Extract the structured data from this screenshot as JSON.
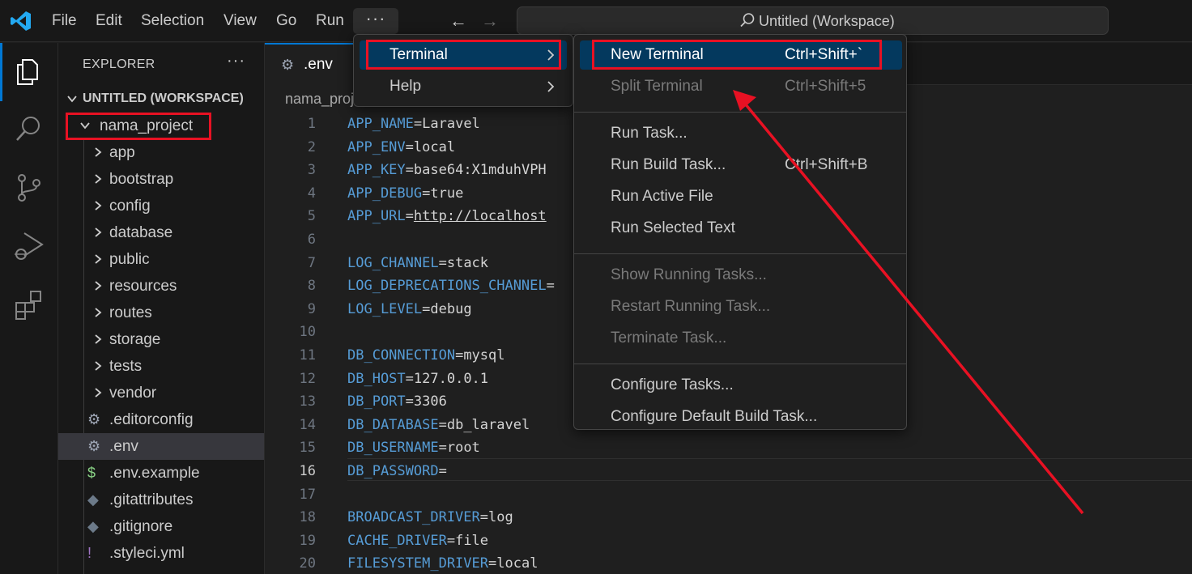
{
  "titlebar": {
    "menus": [
      "File",
      "Edit",
      "Selection",
      "View",
      "Go",
      "Run"
    ],
    "more": "···",
    "search": "Untitled (Workspace)"
  },
  "sidebar": {
    "title": "EXPLORER",
    "more": "···",
    "workspace": "UNTITLED (WORKSPACE)",
    "project": "nama_project",
    "folders": [
      "app",
      "bootstrap",
      "config",
      "database",
      "public",
      "resources",
      "routes",
      "storage",
      "tests",
      "vendor"
    ],
    "files": [
      ".editorconfig",
      ".env",
      ".env.example",
      ".gitattributes",
      ".gitignore",
      ".styleci.yml"
    ]
  },
  "editor": {
    "tab": ".env",
    "breadcrumb": "nama_proj",
    "active_line": 16,
    "lines": [
      {
        "n": "1",
        "k": "APP_NAME",
        "v": "Laravel"
      },
      {
        "n": "2",
        "k": "APP_ENV",
        "v": "local"
      },
      {
        "n": "3",
        "k": "APP_KEY",
        "v": "base64:X1mduhVPH"
      },
      {
        "n": "4",
        "k": "APP_DEBUG",
        "v": "true"
      },
      {
        "n": "5",
        "k": "APP_URL",
        "v": "http://localhost"
      },
      {
        "n": "6",
        "k": "",
        "v": ""
      },
      {
        "n": "7",
        "k": "LOG_CHANNEL",
        "v": "stack"
      },
      {
        "n": "8",
        "k": "LOG_DEPRECATIONS_CHANNEL",
        "v": ""
      },
      {
        "n": "9",
        "k": "LOG_LEVEL",
        "v": "debug"
      },
      {
        "n": "10",
        "k": "",
        "v": ""
      },
      {
        "n": "11",
        "k": "DB_CONNECTION",
        "v": "mysql"
      },
      {
        "n": "12",
        "k": "DB_HOST",
        "v": "127.0.0.1"
      },
      {
        "n": "13",
        "k": "DB_PORT",
        "v": "3306"
      },
      {
        "n": "14",
        "k": "DB_DATABASE",
        "v": "db_laravel"
      },
      {
        "n": "15",
        "k": "DB_USERNAME",
        "v": "root"
      },
      {
        "n": "16",
        "k": "DB_PASSWORD",
        "v": ""
      },
      {
        "n": "17",
        "k": "",
        "v": ""
      },
      {
        "n": "18",
        "k": "BROADCAST_DRIVER",
        "v": "log"
      },
      {
        "n": "19",
        "k": "CACHE_DRIVER",
        "v": "file"
      },
      {
        "n": "20",
        "k": "FILESYSTEM_DRIVER",
        "v": "local"
      }
    ]
  },
  "more_menu": {
    "items": [
      {
        "label": "Terminal",
        "highlighted": true
      },
      {
        "label": "Help",
        "highlighted": false
      }
    ]
  },
  "terminal_menu": {
    "groups": [
      [
        {
          "label": "New Terminal",
          "shortcut": "Ctrl+Shift+`",
          "enabled": true,
          "highlighted": true
        },
        {
          "label": "Split Terminal",
          "shortcut": "Ctrl+Shift+5",
          "enabled": false
        }
      ],
      [
        {
          "label": "Run Task...",
          "shortcut": "",
          "enabled": true
        },
        {
          "label": "Run Build Task...",
          "shortcut": "Ctrl+Shift+B",
          "enabled": true
        },
        {
          "label": "Run Active File",
          "shortcut": "",
          "enabled": true
        },
        {
          "label": "Run Selected Text",
          "shortcut": "",
          "enabled": true
        }
      ],
      [
        {
          "label": "Show Running Tasks...",
          "shortcut": "",
          "enabled": false
        },
        {
          "label": "Restart Running Task...",
          "shortcut": "",
          "enabled": false
        },
        {
          "label": "Terminate Task...",
          "shortcut": "",
          "enabled": false
        }
      ],
      [
        {
          "label": "Configure Tasks...",
          "shortcut": "",
          "enabled": true
        },
        {
          "label": "Configure Default Build Task...",
          "shortcut": "",
          "enabled": true
        }
      ]
    ]
  },
  "colors": {
    "accent": "#0078d4",
    "highlight": "#04395e",
    "annotation": "#e81123"
  }
}
